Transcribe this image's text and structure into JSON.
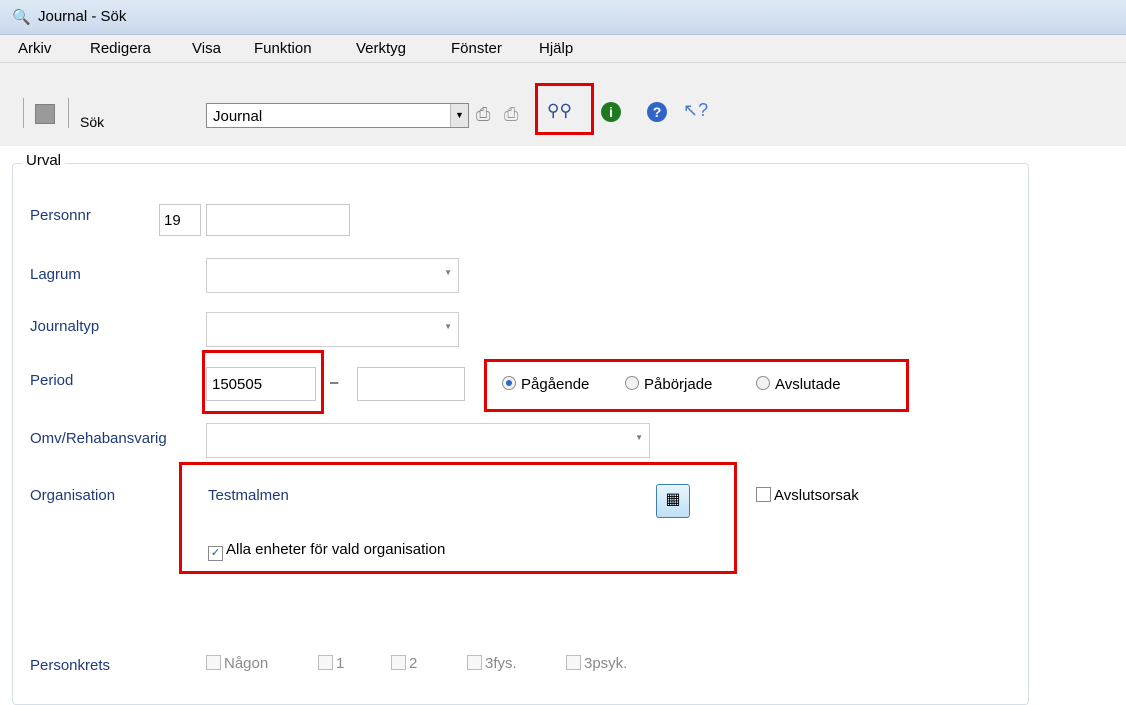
{
  "window": {
    "title": "Journal - Sök",
    "icon": "binoculars-icon"
  },
  "menu": [
    "Arkiv",
    "Redigera",
    "Visa",
    "Funktion",
    "Verktyg",
    "Fönster",
    "Hjälp"
  ],
  "toolbar": {
    "save_icon": "save-icon",
    "search_label": "Sök",
    "combo_value": "Journal",
    "icons": {
      "print": "printer-icon",
      "print_preview": "print-preview-icon",
      "search": "binoculars-icon",
      "info": "info-icon",
      "help": "help-icon",
      "whats_this": "whats-this-icon"
    }
  },
  "form": {
    "group_title": "Urval",
    "personnr": {
      "label": "Personnr",
      "prefix": "19",
      "value": ""
    },
    "lagrum": {
      "label": "Lagrum",
      "value": ""
    },
    "journaltyp": {
      "label": "Journaltyp",
      "value": ""
    },
    "period": {
      "label": "Period",
      "from": "150505",
      "separator": "–",
      "to": "",
      "options": [
        "Pågående",
        "Påbörjade",
        "Avslutade"
      ],
      "selected": "Pågående"
    },
    "omv": {
      "label": "Omv/Rehabansvarig",
      "value": ""
    },
    "organisation": {
      "label": "Organisation",
      "value": "Testmalmen",
      "all_units_label": "Alla enheter för vald organisation",
      "all_units_checked": true,
      "tree_icon": "org-tree-icon"
    },
    "avslutsorsak": {
      "label": "Avslutsorsak",
      "checked": false
    },
    "personkrets": {
      "label": "Personkrets",
      "options": [
        "Någon",
        "1",
        "2",
        "3fys.",
        "3psyk."
      ]
    }
  },
  "highlight_color": "#e30000"
}
